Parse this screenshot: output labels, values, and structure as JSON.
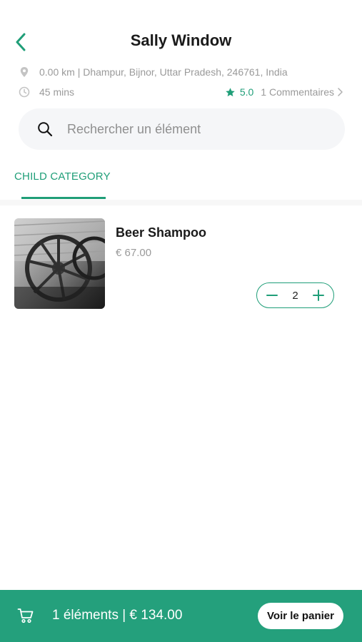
{
  "header": {
    "title": "Sally Window",
    "back_icon": "chevron-left-icon"
  },
  "store_info": {
    "address": "0.00 km | Dhampur, Bijnor, Uttar Pradesh, 246761, India",
    "delivery_time": "45 mins",
    "rating": "5.0",
    "reviews_label": "1 Commentaires"
  },
  "search": {
    "placeholder": "Rechercher un élément"
  },
  "tabs": [
    {
      "label": "CHILD CATEGORY",
      "active": true
    }
  ],
  "products": [
    {
      "name": "Beer Shampoo",
      "price": "€  67.00",
      "quantity": "2"
    }
  ],
  "cart_bar": {
    "summary": "1 éléments | € 134.00",
    "button_label": "Voir le panier"
  },
  "colors": {
    "accent": "#1f9e78",
    "cart_bar": "#24a07c",
    "search_bg": "#f5f6f8",
    "muted_text": "#9a9a9a"
  }
}
